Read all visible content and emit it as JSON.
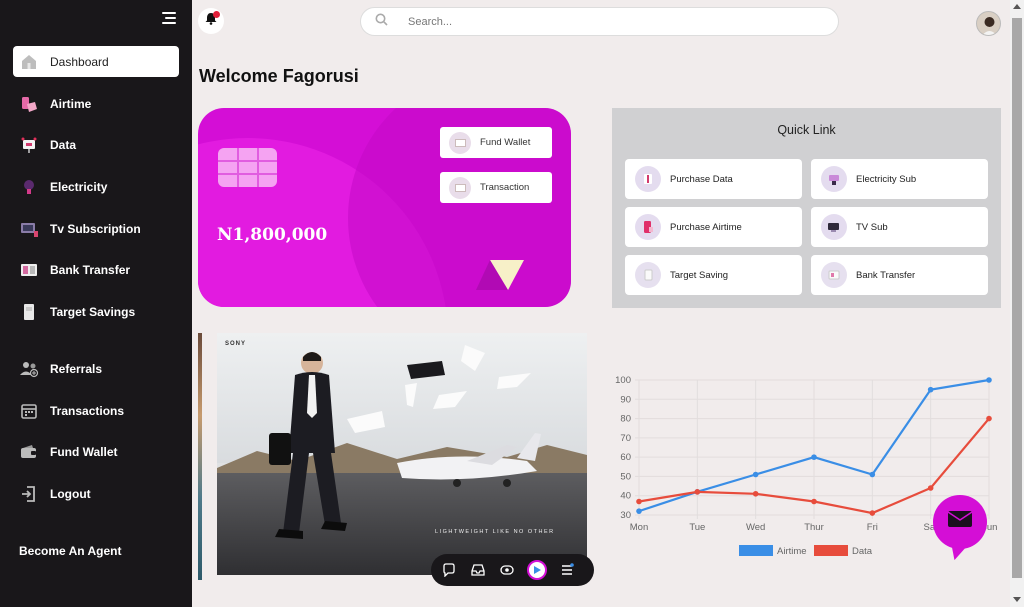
{
  "sidebar": {
    "items": [
      {
        "label": "Dashboard",
        "icon": "home-icon"
      },
      {
        "label": "Airtime",
        "icon": "phone-hand-icon"
      },
      {
        "label": "Data",
        "icon": "data-icon"
      },
      {
        "label": "Electricity",
        "icon": "bulb-icon"
      },
      {
        "label": "Tv Subscription",
        "icon": "tv-icon"
      },
      {
        "label": "Bank Transfer",
        "icon": "bank-icon"
      },
      {
        "label": "Target Savings",
        "icon": "savings-icon"
      },
      {
        "label": "Referrals",
        "icon": "users-icon"
      },
      {
        "label": "Transactions",
        "icon": "calendar-icon"
      },
      {
        "label": "Fund Wallet",
        "icon": "wallet-icon"
      },
      {
        "label": "Logout",
        "icon": "logout-icon"
      }
    ],
    "become_agent": "Become An Agent"
  },
  "header": {
    "search_placeholder": "Search..."
  },
  "welcome": "Welcome Fagorusi",
  "wallet": {
    "balance": "N1,800,000",
    "fund_wallet": "Fund Wallet",
    "transaction": "Transaction"
  },
  "quick_link": {
    "title": "Quick Link",
    "items": [
      {
        "label": "Purchase Data"
      },
      {
        "label": "Electricity Sub"
      },
      {
        "label": "Purchase Airtime"
      },
      {
        "label": "TV Sub"
      },
      {
        "label": "Target Saving"
      },
      {
        "label": "Bank Transfer"
      }
    ]
  },
  "ad": {
    "brand": "SONY",
    "tagline": "LIGHTWEIGHT LIKE NO OTHER"
  },
  "colors": {
    "accent": "#d40ed6",
    "sidebar": "#19171a",
    "airtime": "#3a8ee6",
    "data": "#e74c3c"
  },
  "chart_data": {
    "type": "line",
    "categories": [
      "Mon",
      "Tue",
      "Wed",
      "Thur",
      "Fri",
      "Sat",
      "Sun"
    ],
    "series": [
      {
        "name": "Airtime",
        "values": [
          32,
          42,
          51,
          60,
          51,
          95,
          100
        ],
        "color": "#3a8ee6"
      },
      {
        "name": "Data",
        "values": [
          37,
          42,
          41,
          37,
          31,
          44,
          80
        ],
        "color": "#e74c3c"
      }
    ],
    "ylim": [
      30,
      100
    ],
    "yticks": [
      30,
      40,
      50,
      60,
      70,
      80,
      90,
      100
    ],
    "legend": "bottom",
    "grid": true
  }
}
